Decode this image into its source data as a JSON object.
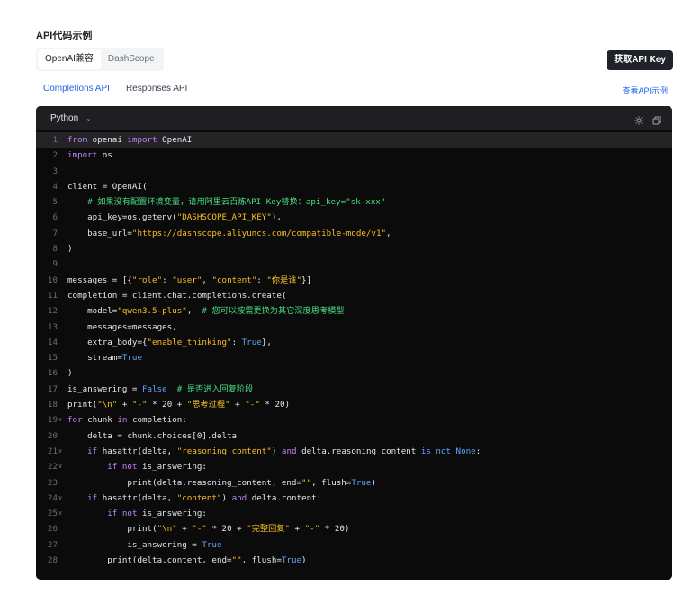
{
  "section_title": "API代码示例",
  "tabs": [
    {
      "label": "OpenAI兼容",
      "active": true
    },
    {
      "label": "DashScope",
      "active": false
    }
  ],
  "get_key_button": "获取API Key",
  "subtabs": [
    {
      "label": "Completions API",
      "active": true
    },
    {
      "label": "Responses API",
      "active": false
    }
  ],
  "view_examples_link": "查看API示例",
  "code_panel": {
    "language": "Python",
    "icons": [
      "sun-icon",
      "copy-icon"
    ],
    "lines": [
      {
        "n": "1",
        "fold": false,
        "segments": [
          {
            "t": "from ",
            "c": "kw"
          },
          {
            "t": "openai ",
            "c": ""
          },
          {
            "t": "import ",
            "c": "kw"
          },
          {
            "t": "OpenAI",
            "c": ""
          }
        ]
      },
      {
        "n": "2",
        "fold": false,
        "segments": [
          {
            "t": "import ",
            "c": "kw"
          },
          {
            "t": "os",
            "c": ""
          }
        ]
      },
      {
        "n": "3",
        "fold": false,
        "segments": []
      },
      {
        "n": "4",
        "fold": false,
        "segments": [
          {
            "t": "client = OpenAI(",
            "c": ""
          }
        ]
      },
      {
        "n": "5",
        "fold": false,
        "segments": [
          {
            "t": "    # 如果没有配置环境变量，请用阿里云百炼API Key替换：api_key=\"sk-xxx\"",
            "c": "cm"
          }
        ]
      },
      {
        "n": "6",
        "fold": false,
        "segments": [
          {
            "t": "    api_key=os.getenv(",
            "c": ""
          },
          {
            "t": "\"DASHSCOPE_API_KEY\"",
            "c": "str"
          },
          {
            "t": "),",
            "c": ""
          }
        ]
      },
      {
        "n": "7",
        "fold": false,
        "segments": [
          {
            "t": "    base_url=",
            "c": ""
          },
          {
            "t": "\"https://dashscope.aliyuncs.com/compatible-mode/v1\"",
            "c": "str"
          },
          {
            "t": ",",
            "c": ""
          }
        ]
      },
      {
        "n": "8",
        "fold": false,
        "segments": [
          {
            "t": ")",
            "c": ""
          }
        ]
      },
      {
        "n": "9",
        "fold": false,
        "segments": []
      },
      {
        "n": "10",
        "fold": false,
        "segments": [
          {
            "t": "messages = [{",
            "c": ""
          },
          {
            "t": "\"role\"",
            "c": "str"
          },
          {
            "t": ": ",
            "c": ""
          },
          {
            "t": "\"user\"",
            "c": "str"
          },
          {
            "t": ", ",
            "c": ""
          },
          {
            "t": "\"content\"",
            "c": "str"
          },
          {
            "t": ": ",
            "c": ""
          },
          {
            "t": "\"你是谁\"",
            "c": "str"
          },
          {
            "t": "}]",
            "c": ""
          }
        ]
      },
      {
        "n": "11",
        "fold": false,
        "segments": [
          {
            "t": "completion = client.chat.completions.create(",
            "c": ""
          }
        ]
      },
      {
        "n": "12",
        "fold": false,
        "segments": [
          {
            "t": "    model=",
            "c": ""
          },
          {
            "t": "\"qwen3.5-plus\"",
            "c": "str"
          },
          {
            "t": ",  ",
            "c": ""
          },
          {
            "t": "# 您可以按需更换为其它深度思考模型",
            "c": "cm"
          }
        ]
      },
      {
        "n": "13",
        "fold": false,
        "segments": [
          {
            "t": "    messages=messages,",
            "c": ""
          }
        ]
      },
      {
        "n": "14",
        "fold": false,
        "segments": [
          {
            "t": "    extra_body={",
            "c": ""
          },
          {
            "t": "\"enable_thinking\"",
            "c": "str"
          },
          {
            "t": ": ",
            "c": ""
          },
          {
            "t": "True",
            "c": "bl"
          },
          {
            "t": "},",
            "c": ""
          }
        ]
      },
      {
        "n": "15",
        "fold": false,
        "segments": [
          {
            "t": "    stream=",
            "c": ""
          },
          {
            "t": "True",
            "c": "bl"
          }
        ]
      },
      {
        "n": "16",
        "fold": false,
        "segments": [
          {
            "t": ")",
            "c": ""
          }
        ]
      },
      {
        "n": "17",
        "fold": false,
        "segments": [
          {
            "t": "is_answering = ",
            "c": ""
          },
          {
            "t": "False",
            "c": "bl"
          },
          {
            "t": "  ",
            "c": ""
          },
          {
            "t": "# 是否进入回复阶段",
            "c": "cm"
          }
        ]
      },
      {
        "n": "18",
        "fold": false,
        "segments": [
          {
            "t": "print(",
            "c": ""
          },
          {
            "t": "\"\\n\"",
            "c": "str"
          },
          {
            "t": " + ",
            "c": ""
          },
          {
            "t": "\"-\"",
            "c": "str"
          },
          {
            "t": " * 20 + ",
            "c": ""
          },
          {
            "t": "\"思考过程\"",
            "c": "str"
          },
          {
            "t": " + ",
            "c": ""
          },
          {
            "t": "\"-\"",
            "c": "str"
          },
          {
            "t": " * 20)",
            "c": ""
          }
        ]
      },
      {
        "n": "19",
        "fold": true,
        "segments": [
          {
            "t": "for ",
            "c": "kw"
          },
          {
            "t": "chunk ",
            "c": ""
          },
          {
            "t": "in ",
            "c": "kw"
          },
          {
            "t": "completion:",
            "c": ""
          }
        ]
      },
      {
        "n": "20",
        "fold": false,
        "segments": [
          {
            "t": "    delta = chunk.choices[0].delta",
            "c": ""
          }
        ]
      },
      {
        "n": "21",
        "fold": true,
        "segments": [
          {
            "t": "    ",
            "c": ""
          },
          {
            "t": "if ",
            "c": "kw"
          },
          {
            "t": "hasattr(delta, ",
            "c": ""
          },
          {
            "t": "\"reasoning_content\"",
            "c": "str"
          },
          {
            "t": ") ",
            "c": ""
          },
          {
            "t": "and ",
            "c": "kw"
          },
          {
            "t": "delta.reasoning_content ",
            "c": ""
          },
          {
            "t": "is not None",
            "c": "bl"
          },
          {
            "t": ":",
            "c": ""
          }
        ]
      },
      {
        "n": "22",
        "fold": true,
        "segments": [
          {
            "t": "        ",
            "c": ""
          },
          {
            "t": "if not ",
            "c": "kw"
          },
          {
            "t": "is_answering:",
            "c": ""
          }
        ]
      },
      {
        "n": "23",
        "fold": false,
        "segments": [
          {
            "t": "            print(delta.reasoning_content, end=",
            "c": ""
          },
          {
            "t": "\"\"",
            "c": "str"
          },
          {
            "t": ", flush=",
            "c": ""
          },
          {
            "t": "True",
            "c": "bl"
          },
          {
            "t": ")",
            "c": ""
          }
        ]
      },
      {
        "n": "24",
        "fold": true,
        "segments": [
          {
            "t": "    ",
            "c": ""
          },
          {
            "t": "if ",
            "c": "kw"
          },
          {
            "t": "hasattr(delta, ",
            "c": ""
          },
          {
            "t": "\"content\"",
            "c": "str"
          },
          {
            "t": ") ",
            "c": ""
          },
          {
            "t": "and ",
            "c": "kw"
          },
          {
            "t": "delta.content:",
            "c": ""
          }
        ]
      },
      {
        "n": "25",
        "fold": true,
        "segments": [
          {
            "t": "        ",
            "c": ""
          },
          {
            "t": "if not ",
            "c": "kw"
          },
          {
            "t": "is_answering:",
            "c": ""
          }
        ]
      },
      {
        "n": "26",
        "fold": false,
        "segments": [
          {
            "t": "            print(",
            "c": ""
          },
          {
            "t": "\"\\n\"",
            "c": "str"
          },
          {
            "t": " + ",
            "c": ""
          },
          {
            "t": "\"-\"",
            "c": "str"
          },
          {
            "t": " * 20 + ",
            "c": ""
          },
          {
            "t": "\"完整回复\"",
            "c": "str"
          },
          {
            "t": " + ",
            "c": ""
          },
          {
            "t": "\"-\"",
            "c": "str"
          },
          {
            "t": " * 20)",
            "c": ""
          }
        ]
      },
      {
        "n": "27",
        "fold": false,
        "segments": [
          {
            "t": "            is_answering = ",
            "c": ""
          },
          {
            "t": "True",
            "c": "bl"
          }
        ]
      },
      {
        "n": "28",
        "fold": false,
        "segments": [
          {
            "t": "        print(delta.content, end=",
            "c": ""
          },
          {
            "t": "\"\"",
            "c": "str"
          },
          {
            "t": ", flush=",
            "c": ""
          },
          {
            "t": "True",
            "c": "bl"
          },
          {
            "t": ")",
            "c": ""
          }
        ]
      }
    ]
  }
}
